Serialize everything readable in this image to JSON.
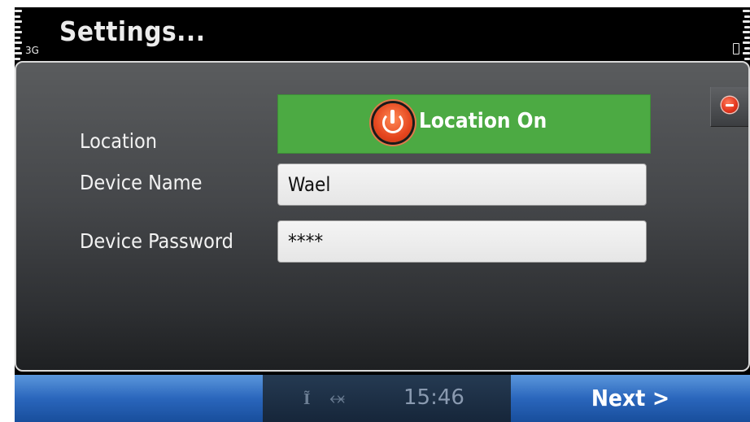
{
  "status_bar": {
    "network": "3G",
    "title": "Settings..."
  },
  "form": {
    "location": {
      "label": "Location",
      "toggle_text": "Location On",
      "toggle_color": "#4caa43"
    },
    "device_name": {
      "label": "Device Name",
      "value": "Wael"
    },
    "device_password": {
      "label": "Device Password",
      "value": "****"
    }
  },
  "softkeys": {
    "right_label": "Next >"
  },
  "indicators": {
    "clock": "15:46",
    "antenna_icon": "antenna-icon",
    "usb_icon": "usb-icon"
  },
  "colors": {
    "softkey_blue": "#2a66bc",
    "close_red": "#e2341c"
  }
}
